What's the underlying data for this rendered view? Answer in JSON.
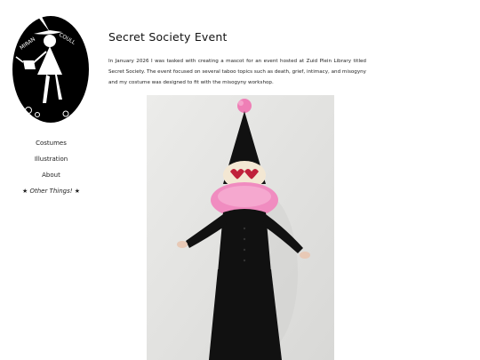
{
  "logo": {
    "label_left": "MIRAN",
    "label_right": "COULL"
  },
  "nav": {
    "items": [
      {
        "label": "Costumes"
      },
      {
        "label": "Illustration"
      },
      {
        "label": "About"
      }
    ],
    "special": {
      "star": "★",
      "label": "Other Things!"
    }
  },
  "post": {
    "title": "Secret Society Event",
    "description": "In January 2026 I was tasked with creating a mascot for an event hosted at Zuid Plein Library titled Secret Society. The event focused on several taboo topics such as death, grief, intimacy, and misogyny and my costume was designed to fit with the misogyny workshop."
  },
  "colors": {
    "background": "#ffffff",
    "text": "#1a1a1a",
    "logo_fill": "#000000",
    "costume_black": "#111111",
    "ruff_pink": "#f08cc0",
    "pompom_pink": "#ef7fb6",
    "mask_cream": "#f3e7d3",
    "heart_red": "#c0203a"
  }
}
